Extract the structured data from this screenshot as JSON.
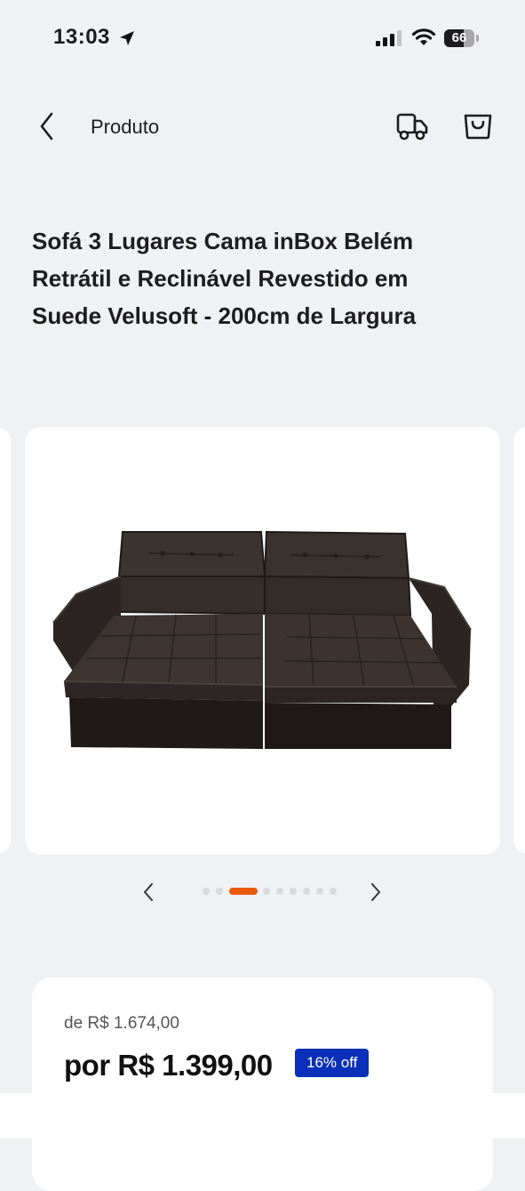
{
  "status_bar": {
    "time": "13:03",
    "battery_percent": 66,
    "battery_label": "66",
    "icons": [
      "location-arrow-icon",
      "cellular-signal-icon",
      "wifi-icon",
      "battery-icon"
    ]
  },
  "header": {
    "title": "Produto",
    "icons": [
      "chevron-left-icon",
      "delivery-truck-icon",
      "shopping-bag-icon"
    ]
  },
  "product": {
    "title": "Sofá 3 Lugares Cama inBox Belém Retrátil e Reclinável Revestido em Suede Velusoft - 200cm de Largura",
    "image": "sofa-image"
  },
  "gallery": {
    "image_count": 9,
    "active_index": 2,
    "icons": [
      "chevron-left-icon",
      "chevron-right-icon"
    ],
    "accent_color": "#e8590c"
  },
  "price": {
    "old_price": "de R$ 1.674,00",
    "current_price": "por R$ 1.399,00",
    "discount": "16% off",
    "badge_color": "#0a2fb8"
  }
}
